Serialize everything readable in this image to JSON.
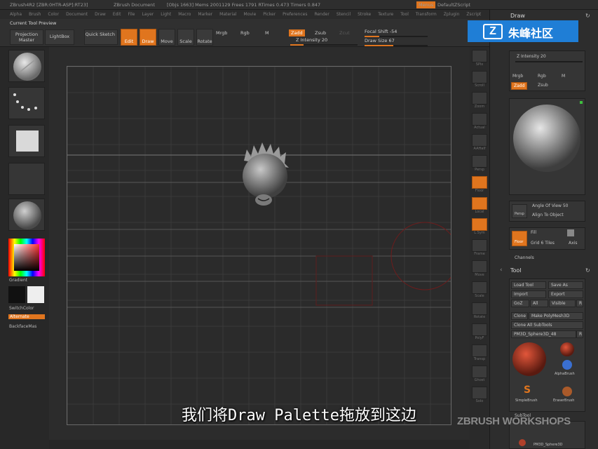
{
  "titlebar": {
    "app": "ZBrush4R2 [ZBR:0HTR-ASP]:RT23]",
    "document": "ZBrush Document",
    "stats": "[Objs 1663] Mems 2001129 Frees 1791 RTimes 0.473 Timers 0.847",
    "menus_button": "Menus",
    "script": "DefaultZScript"
  },
  "menubar": [
    "Alpha",
    "Brush",
    "Color",
    "Document",
    "Draw",
    "Edit",
    "File",
    "Layer",
    "Light",
    "Macro",
    "Marker",
    "Material",
    "Movie",
    "Picker",
    "Preferences",
    "Render",
    "Stencil",
    "Stroke",
    "Texture",
    "Tool",
    "Transform",
    "Zplugin",
    "Zscript"
  ],
  "toolbar": {
    "current_tool": "Current Tool Preview",
    "projection_master": "Projection Master",
    "lightbox": "LightBox",
    "quick_sketch": "Quick Sketch",
    "edit": "Edit",
    "draw": "Draw",
    "move": "Move",
    "scale": "Scale",
    "rotate": "Rotate",
    "mrgb": "Mrgb",
    "rgb": "Rgb",
    "m": "M",
    "zadd": "Zadd",
    "zsub": "Zsub",
    "zcut": "Zcut",
    "z_intensity": "Z Intensity 20",
    "focal_shift": "Focal Shift -54",
    "draw_size": "Draw Size 67",
    "z_intensity_value": 0.2,
    "focal_shift_value": 0.23,
    "draw_size_value": 0.45
  },
  "leftshelf": {
    "gradient": "Gradient",
    "switch_color": "SwitchColor",
    "alternate": "Alternate",
    "backface": "BackfaceMas"
  },
  "rightshelf": [
    "SPix",
    "Scroll",
    "Zoom",
    "Actual",
    "AAHalf",
    "Persp",
    "Floor",
    "Local",
    "L.Sym",
    "Frame",
    "Move",
    "Scale",
    "Rotate",
    "PolyF",
    "Transp",
    "Ghost",
    "Solo"
  ],
  "tray": {
    "draw_title": "Draw",
    "z_intensity": "Z Intensity 20",
    "mrgb": "Mrgb",
    "rgb": "Rgb",
    "m": "M",
    "zadd": "Zadd",
    "zsub": "Zsub",
    "angle_of_view": "Angle Of View 50",
    "align_to_object": "Align To Object",
    "persp": "Persp",
    "fill": "Fill",
    "floor": "Floor",
    "grid_tiles": "Grid 6 Tiles",
    "axis": "Axis",
    "channels": "Channels",
    "tool_title": "Tool",
    "load_tool": "Load Tool",
    "save_as": "Save As",
    "import": "Import",
    "export": "Export",
    "goz": "GoZ",
    "all": "All",
    "visible": "Visible",
    "r": "R",
    "clone": "Clone",
    "make_polymesh": "Make PolyMesh3D",
    "clone_all": "Clone All SubTools",
    "pm_sphere": "PM3D_Sphere3D_48",
    "simple_brush": "SimpleBrush",
    "eraser_brush": "EraserBrush",
    "subtool": "SubTool",
    "alpha_brush": "AlphaBrush",
    "pm_sphere_sub": "PM3D_Sphere3D"
  },
  "subtitle": "我们将Draw Palette拖放到这边",
  "watermark": "ZBRUSH WORKSHOPS",
  "logo_text": "朱峰社区",
  "colors": {
    "accent": "#e0751e",
    "bg": "#262626",
    "logo_blue": "#1f7ed6"
  }
}
